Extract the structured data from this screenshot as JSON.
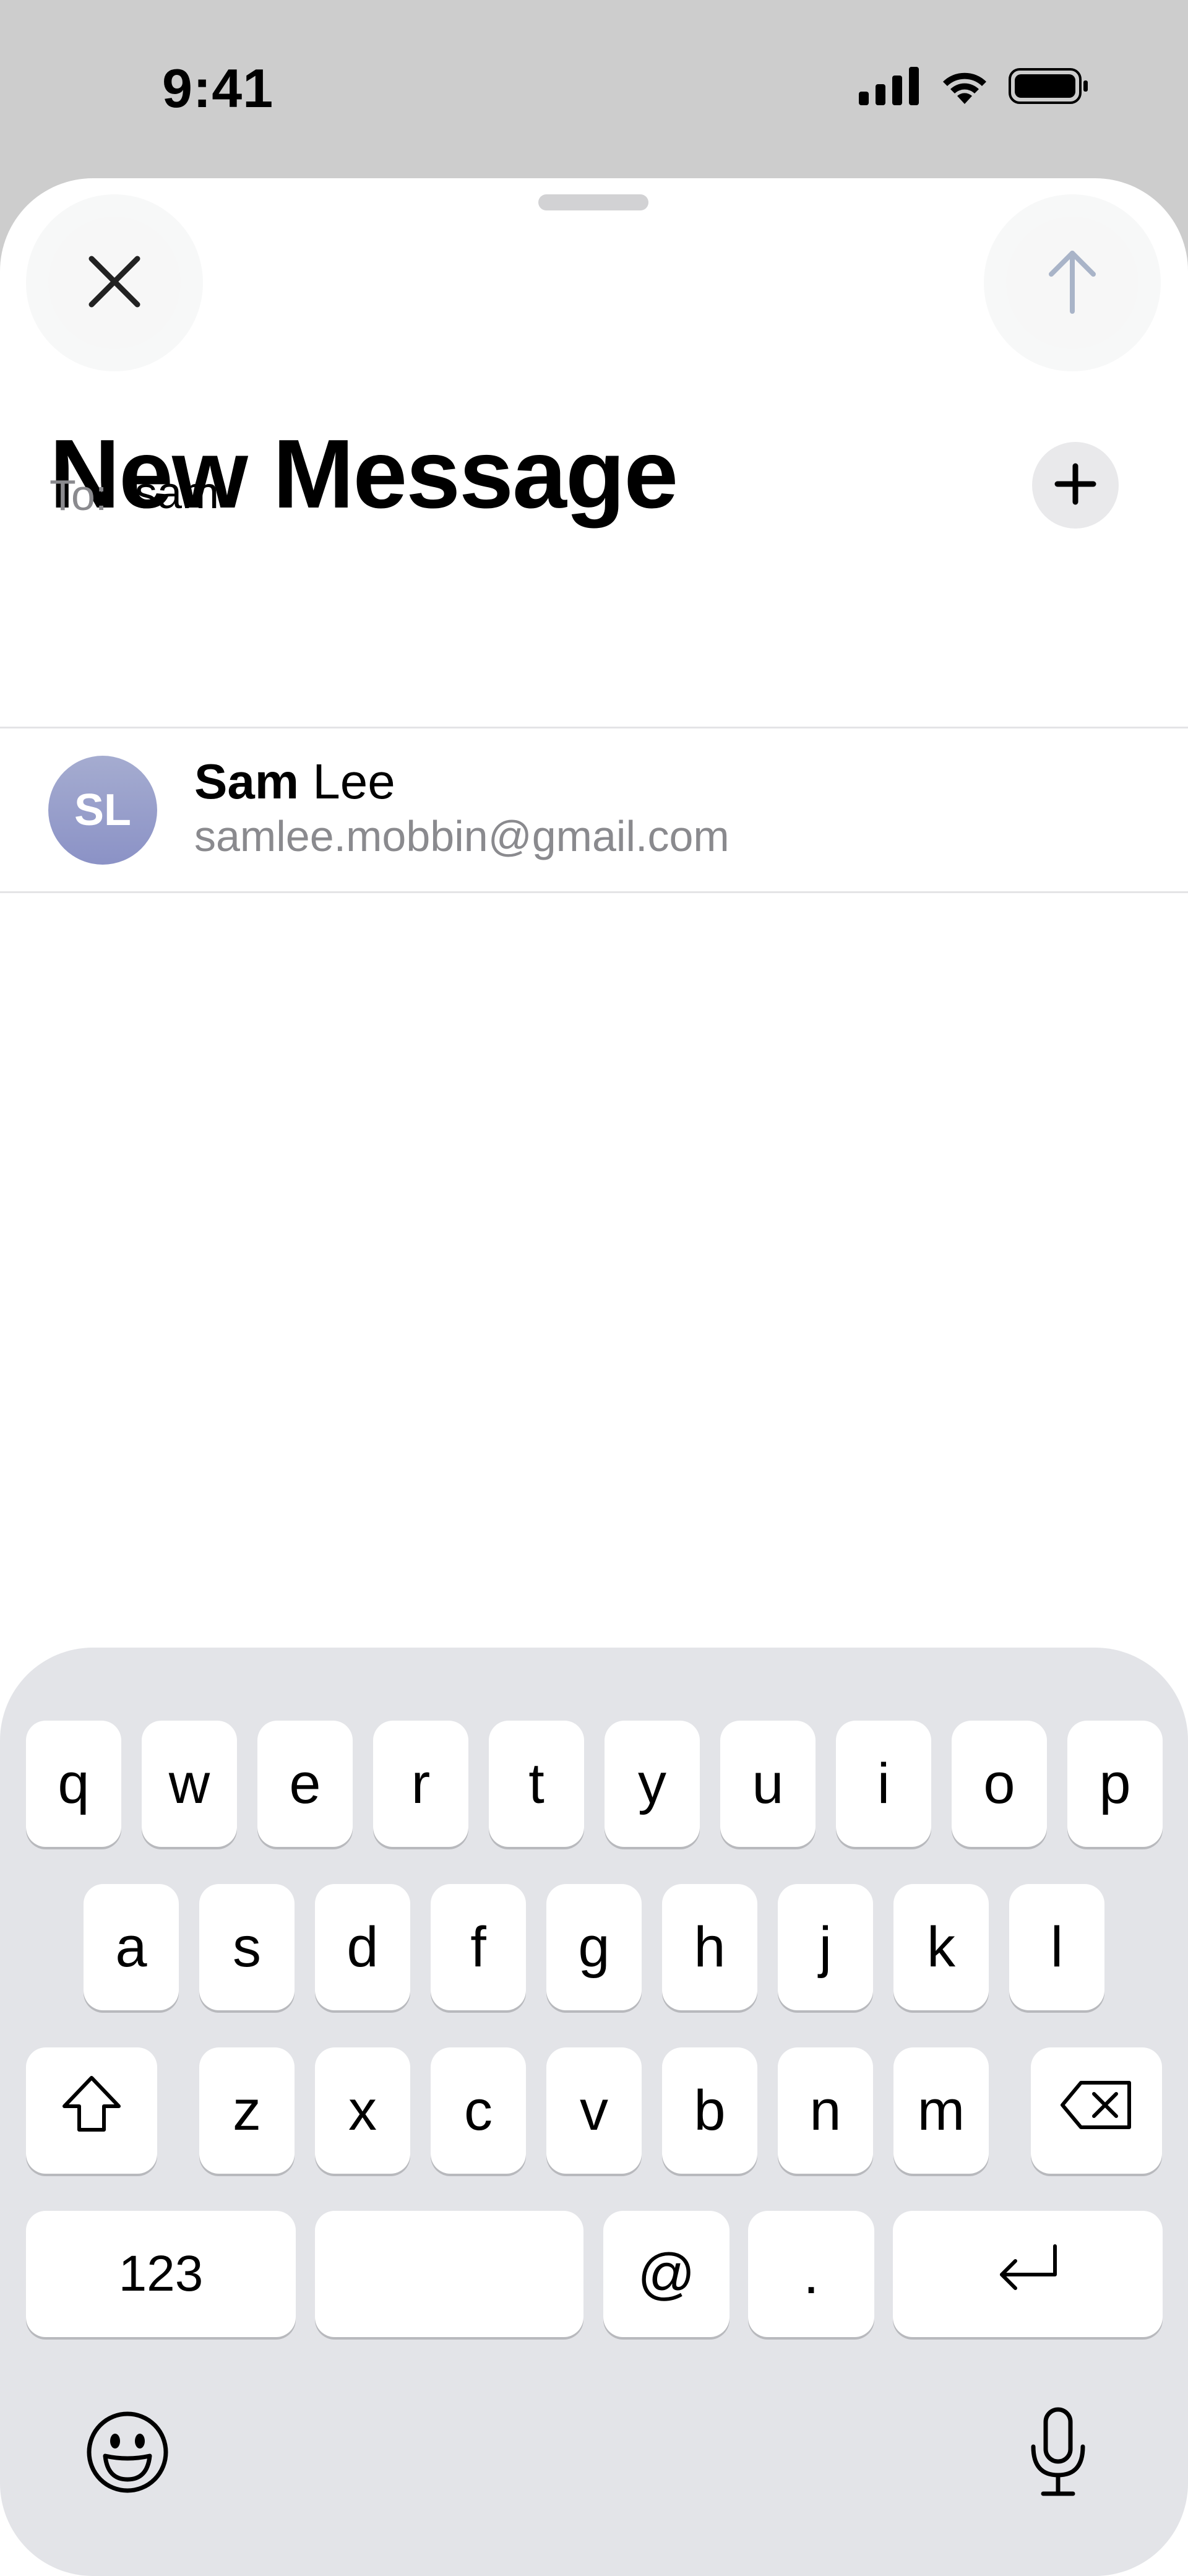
{
  "status_bar": {
    "time": "9:41",
    "icons": [
      "signal-icon",
      "wifi-icon",
      "battery-icon"
    ]
  },
  "header": {
    "title": "New Message",
    "close_icon": "close-icon",
    "send_icon": "arrow-up-icon"
  },
  "recipient": {
    "label": "To:",
    "value": "sam",
    "add_icon": "plus-icon"
  },
  "suggestion": {
    "initials": "SL",
    "name_bold": "Sam",
    "name_rest": " Lee",
    "email": "samlee.mobbin@gmail.com"
  },
  "keyboard": {
    "row1": [
      "q",
      "w",
      "e",
      "r",
      "t",
      "y",
      "u",
      "i",
      "o",
      "p"
    ],
    "row2": [
      "a",
      "s",
      "d",
      "f",
      "g",
      "h",
      "j",
      "k",
      "l"
    ],
    "row3": [
      "z",
      "x",
      "c",
      "v",
      "b",
      "n",
      "m"
    ],
    "numbers_label": "123",
    "at_label": "@",
    "dot_label": ".",
    "shift_icon": "shift-icon",
    "delete_icon": "delete-icon",
    "return_icon": "return-icon",
    "emoji_icon": "emoji-icon",
    "mic_icon": "microphone-icon"
  },
  "colors": {
    "avatar": "#8b92c6",
    "send_arrow": "#a9b4c8",
    "keyboard_bg": "#e3e4e8"
  }
}
